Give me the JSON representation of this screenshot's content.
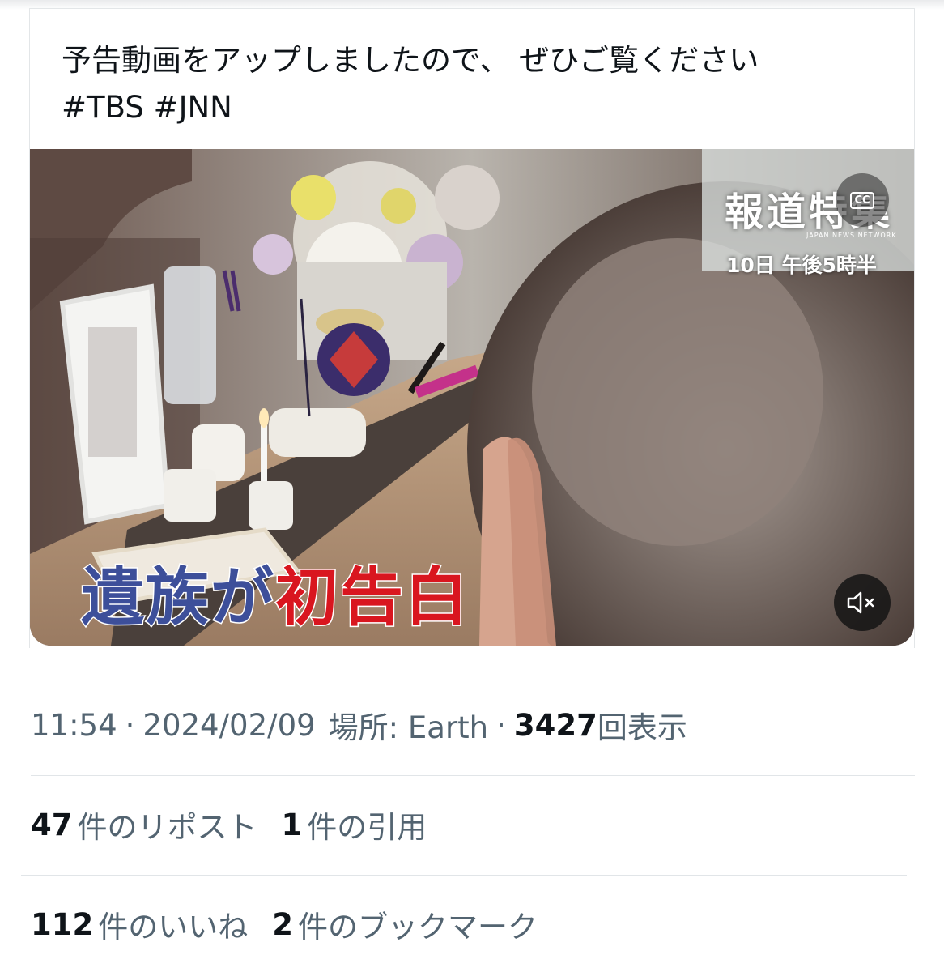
{
  "quote": {
    "text": "予告動画をアップしましたので、 ぜひご覧ください\n#TBS #JNN"
  },
  "video": {
    "caption_part1": "遺族が",
    "caption_part2": "初告白",
    "program_title": "報道特集",
    "program_network": "JAPAN NEWS NETWORK",
    "program_time": "10日 午後5時半",
    "cc_label": "CC",
    "mute_icon": "mute-icon"
  },
  "meta": {
    "time": "11:54",
    "separator": "·",
    "date": "2024/02/09",
    "location_label": "場所: Earth",
    "views_count": "3427",
    "views_label": "回表示"
  },
  "stats": {
    "reposts_count": "47",
    "reposts_label": "件のリポスト",
    "quotes_count": "1",
    "quotes_label": "件の引用",
    "likes_count": "112",
    "likes_label": "件のいいね",
    "bookmarks_count": "2",
    "bookmarks_label": "件のブックマーク"
  },
  "colors": {
    "text_primary": "#0f1419",
    "text_secondary": "#536471",
    "divider": "#e1e5e8",
    "caption_blue": "#3d4f9a",
    "caption_red": "#d9161f"
  }
}
